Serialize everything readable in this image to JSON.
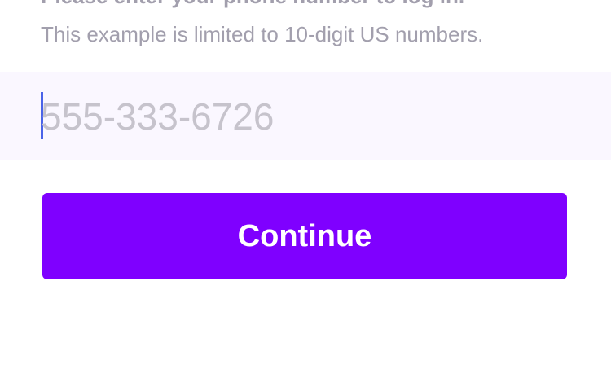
{
  "header": {
    "title": "Please enter your phone number to log in.",
    "subtitle": "This example is limited to 10-digit US numbers."
  },
  "phone_input": {
    "value": "",
    "placeholder": "555-333-6726"
  },
  "continue_button": {
    "label": "Continue"
  },
  "colors": {
    "primary": "#7F00FF",
    "caret": "#4A63E8",
    "muted_text": "#A29FAD",
    "input_background": "#FAF7FF"
  }
}
